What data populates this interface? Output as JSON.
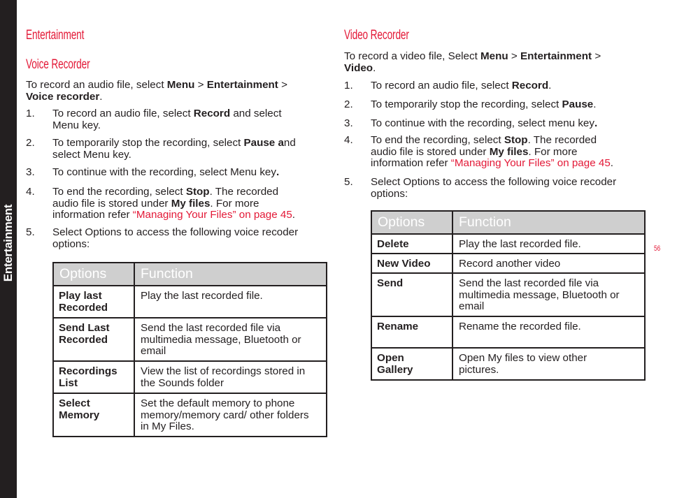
{
  "side_tab": {
    "label": "Entertainment"
  },
  "page_number": "56",
  "colors": {
    "accent": "#e31937",
    "text": "#231f20",
    "table_header_bg": "#cfcfcf",
    "side_tab_bg": "#231f20"
  },
  "left": {
    "section_title": "Entertainment",
    "heading": "Voice Recorder",
    "intro": {
      "pre": "To record an audio file, select ",
      "b1": "Menu",
      "sep1": " > ",
      "b2": "Entertainment",
      "sep2": " >",
      "b3": "Voice recorder",
      "end": "."
    },
    "steps": [
      {
        "num": "1.",
        "pre": "To record an audio file, select ",
        "bold": "Record",
        "post": " and select Menu key."
      },
      {
        "num": "2.",
        "pre": "To temporarily stop the recording, select ",
        "bold": "Pause a",
        "post": "nd select Menu key."
      },
      {
        "num": "3.",
        "pre": "To continue with the recording, select Menu key",
        "bold": ".",
        "post": ""
      },
      {
        "num": "4.",
        "pre": "To end the recording, select ",
        "bold": "Stop",
        "mid": ". The recorded audio file is stored under ",
        "bold2": "My files",
        "mid2": ". For more information refer ",
        "link": "“Managing Your Files” on page 45",
        "post": "."
      },
      {
        "num": "5.",
        "pre": "Select Options to access the following voice recoder options:",
        "bold": "",
        "post": ""
      }
    ],
    "table": {
      "headers": [
        "Options",
        "Function"
      ],
      "rows": [
        {
          "option": "Play last Recorded",
          "function": "Play the last recorded file."
        },
        {
          "option": "Send Last Recorded",
          "function": "Send the last recorded file via multimedia message, Bluetooth or email"
        },
        {
          "option": "Recordings List",
          "function": "View the list of recordings stored in the Sounds folder"
        },
        {
          "option": "Select Memory",
          "function": "Set the default memory to phone memory/memory card/ other folders in My Files."
        }
      ]
    }
  },
  "right": {
    "heading": "Video Recorder",
    "intro": {
      "pre": "To record a video file, Select ",
      "b1": "Menu",
      "sep1": " > ",
      "b2": "Entertainment",
      "sep2": " >",
      "b3": "Video",
      "end": "."
    },
    "steps": [
      {
        "num": "1.",
        "pre": "To record an audio file, select ",
        "bold": "Record",
        "post": "."
      },
      {
        "num": "2.",
        "pre": "To temporarily stop the recording, select ",
        "bold": "Pause",
        "post": "."
      },
      {
        "num": "3.",
        "pre": "To continue with the recording, select menu key",
        "bold": ".",
        "post": ""
      },
      {
        "num": "4.",
        "pre": "To end the recording, select ",
        "bold": "Stop",
        "mid": ". The recorded audio file is stored under ",
        "bold2": "My files",
        "mid2": ". For more information refer ",
        "link": "“Managing Your Files” on page 45",
        "post": "."
      },
      {
        "num": "5.",
        "pre": "Select Options to access the following voice recoder options:",
        "bold": "",
        "post": ""
      }
    ],
    "table": {
      "headers": [
        "Options",
        "Function"
      ],
      "rows": [
        {
          "option": "Delete",
          "function": "Play the last recorded file."
        },
        {
          "option": "New Video",
          "function": "Record another video"
        },
        {
          "option": "Send",
          "function": "Send the last recorded file via multimedia message, Bluetooth or email"
        },
        {
          "option": "Rename",
          "function": "Rename the recorded file."
        },
        {
          "option": "Open Gallery",
          "function": "Open My files to view other pictures."
        }
      ]
    }
  }
}
